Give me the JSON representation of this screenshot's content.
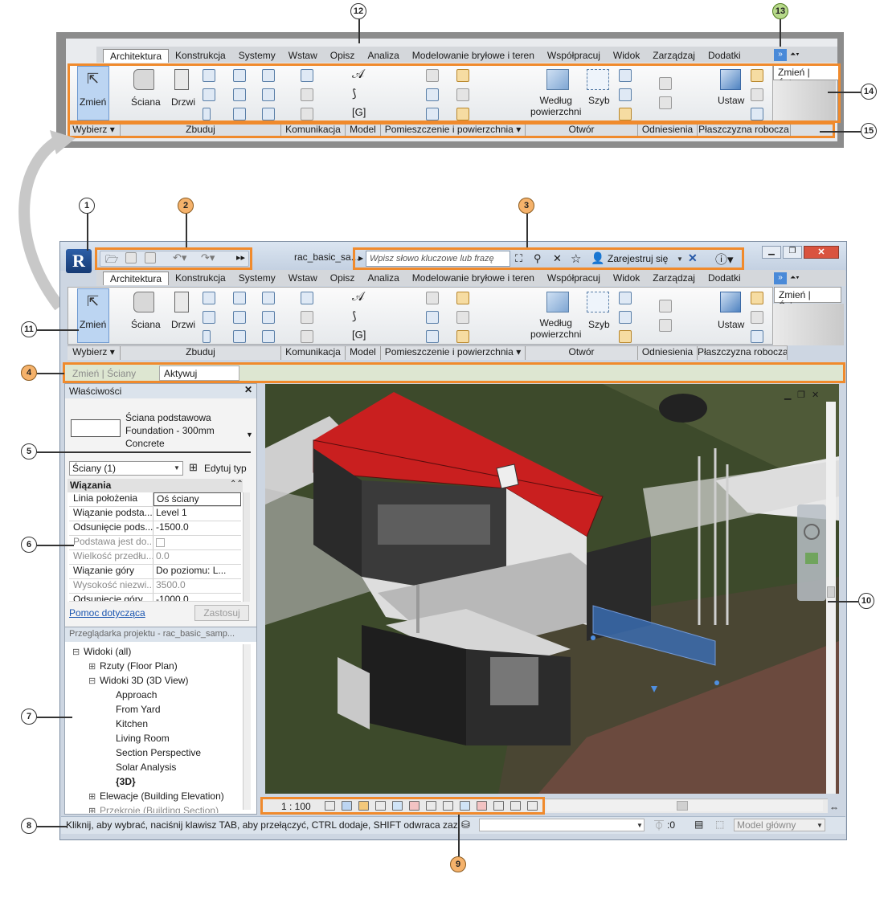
{
  "callouts": [
    "1",
    "2",
    "3",
    "4",
    "5",
    "6",
    "7",
    "8",
    "9",
    "10",
    "11",
    "12",
    "13",
    "14",
    "15"
  ],
  "tabs": [
    "Architektura",
    "Konstrukcja",
    "Systemy",
    "Wstaw",
    "Opisz",
    "Analiza",
    "Modelowanie bryłowe i teren",
    "Współpracuj",
    "Widok",
    "Zarządzaj",
    "Dodatki"
  ],
  "tab_context": "Zmień | Ściany",
  "ribbon": {
    "modify": "Zmień",
    "wall": "Ściana",
    "door": "Drzwi",
    "by_face": "Według\npowierzchni",
    "shaft": "Szyb",
    "set": "Ustaw"
  },
  "panels": [
    "Wybierz ▾",
    "Zbuduj",
    "Komunikacja",
    "Model",
    "Pomieszczenie i powierzchnia ▾",
    "Otwór",
    "Odniesienia",
    "Płaszczyzna robocza"
  ],
  "title_bar": {
    "file_name": "rac_basic_sa...",
    "search_placeholder": "Wpisz słowo kluczowe lub frazę",
    "sign_in": "Zarejestruj się"
  },
  "options_bar": {
    "context": "Zmień | Ściany",
    "activate": "Aktywuj wymiary"
  },
  "properties": {
    "title": "Właściwości",
    "type_line1": "Ściana podstawowa",
    "type_line2": "Foundation - 300mm",
    "type_line3": "Concrete",
    "selector": "Ściany (1)",
    "edit_type": "Edytuj typ",
    "group": "Wiązania",
    "rows": [
      {
        "k": "Linia położenia",
        "v": "Oś ściany"
      },
      {
        "k": "Wiązanie podsta...",
        "v": "Level 1"
      },
      {
        "k": "Odsunięcie pods...",
        "v": "-1500.0"
      },
      {
        "k": "Podstawa jest do...",
        "v": ""
      },
      {
        "k": "Wielkość przedłu...",
        "v": "0.0"
      },
      {
        "k": "Wiązanie góry",
        "v": "Do poziomu: L..."
      },
      {
        "k": "Wysokość niezwi...",
        "v": "3500.0"
      },
      {
        "k": "Odsunięcie góry",
        "v": "-1000.0"
      }
    ],
    "help": "Pomoc dotycząca",
    "apply": "Zastosuj"
  },
  "browser": {
    "title": "Przeglądarka projektu - rac_basic_samp...",
    "items": [
      {
        "t": "Widoki (all)",
        "lvl": 0,
        "exp": "⊟"
      },
      {
        "t": "Rzuty (Floor Plan)",
        "lvl": 1,
        "exp": "⊞"
      },
      {
        "t": "Widoki 3D (3D View)",
        "lvl": 1,
        "exp": "⊟"
      },
      {
        "t": "Approach",
        "lvl": 2,
        "exp": ""
      },
      {
        "t": "From Yard",
        "lvl": 2,
        "exp": ""
      },
      {
        "t": "Kitchen",
        "lvl": 2,
        "exp": ""
      },
      {
        "t": "Living Room",
        "lvl": 2,
        "exp": ""
      },
      {
        "t": "Section Perspective",
        "lvl": 2,
        "exp": ""
      },
      {
        "t": "Solar Analysis",
        "lvl": 2,
        "exp": ""
      },
      {
        "t": "{3D}",
        "lvl": 2,
        "exp": ""
      },
      {
        "t": "Elewacje (Building Elevation)",
        "lvl": 1,
        "exp": "⊞"
      },
      {
        "t": "Przekroje (Building Section)",
        "lvl": 1,
        "exp": "⊞"
      }
    ]
  },
  "view_control": {
    "scale": "1 : 100"
  },
  "status": {
    "text": "Kliknij, aby wybrać, naciśnij klawisz TAB, aby przełączyć, CTRL dodaje, SHIFT odwraca zazna",
    "count": ":0",
    "model": "Model główny"
  }
}
